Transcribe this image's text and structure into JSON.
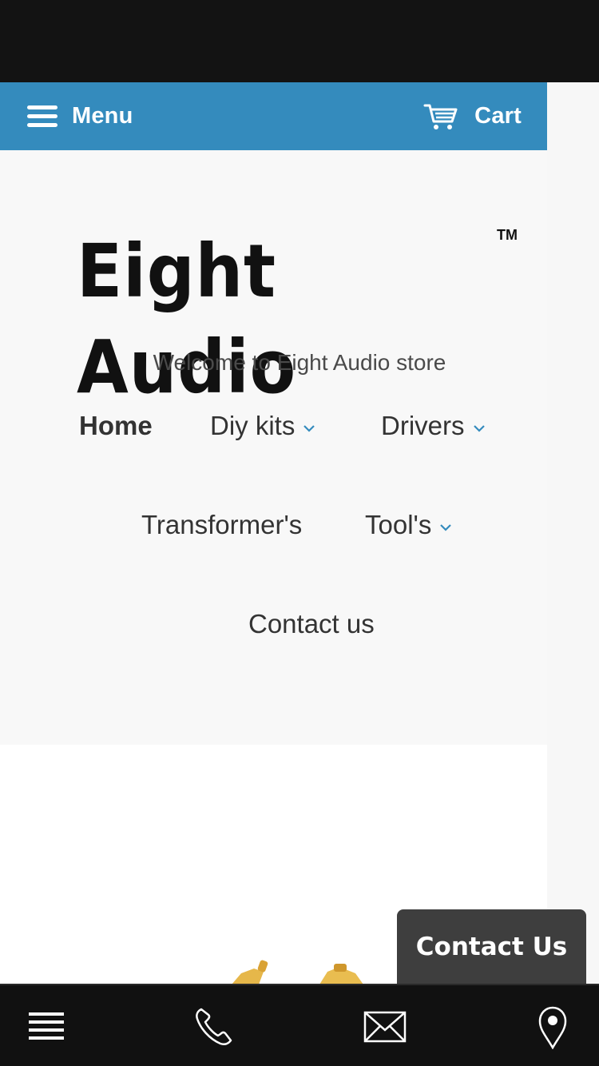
{
  "topbar": {
    "menu_label": "Menu",
    "menu_icon": "hamburger-icon",
    "cart_label": "Cart",
    "cart_icon": "cart-icon",
    "background": "#348bbd"
  },
  "header": {
    "logo_text": "Eight Audio",
    "logo_tm": "TM",
    "tagline": "Welcome to Eight Audio store"
  },
  "nav": {
    "items": [
      {
        "label": "Home",
        "active": true,
        "has_dropdown": false
      },
      {
        "label": "Diy kits",
        "active": false,
        "has_dropdown": true
      },
      {
        "label": "Drivers",
        "active": false,
        "has_dropdown": true
      },
      {
        "label": "Transformer's",
        "active": false,
        "has_dropdown": false
      },
      {
        "label": "Tool's",
        "active": false,
        "has_dropdown": true
      },
      {
        "label": "Contact us",
        "active": false,
        "has_dropdown": false
      }
    ],
    "dropdown_icon": "chevron-down-icon",
    "accent": "#348bbd"
  },
  "contact_widget": {
    "label": "Contact Us",
    "background": "#3e3e3e"
  },
  "bottom_bar": {
    "icons": [
      "list-icon",
      "phone-icon",
      "mail-icon",
      "location-pin-icon"
    ],
    "background": "#111111"
  }
}
